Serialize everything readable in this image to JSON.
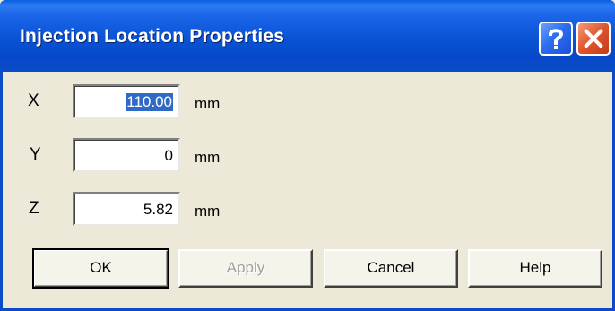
{
  "window": {
    "title": "Injection Location Properties"
  },
  "titlebar": {
    "help_icon": "question-icon",
    "close_icon": "close-icon"
  },
  "fields": [
    {
      "label": "X",
      "value": "110.00",
      "unit": "mm",
      "selected": true
    },
    {
      "label": "Y",
      "value": "0",
      "unit": "mm",
      "selected": false
    },
    {
      "label": "Z",
      "value": "5.82",
      "unit": "mm",
      "selected": false
    }
  ],
  "buttons": {
    "ok": "OK",
    "apply": "Apply",
    "cancel": "Cancel",
    "help": "Help"
  },
  "colors": {
    "titlebar": "#0A55D8",
    "dialog_bg": "#ECE9D8",
    "selection": "#316AC5",
    "close_button": "#E0542D"
  }
}
